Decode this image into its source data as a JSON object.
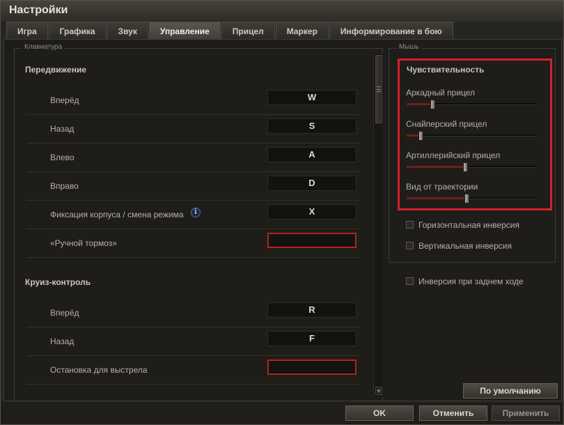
{
  "window": {
    "title": "Настройки"
  },
  "tabs": [
    {
      "label": "Игра",
      "active": false
    },
    {
      "label": "Графика",
      "active": false
    },
    {
      "label": "Звук",
      "active": false
    },
    {
      "label": "Управление",
      "active": true
    },
    {
      "label": "Прицел",
      "active": false
    },
    {
      "label": "Маркер",
      "active": false
    },
    {
      "label": "Информирование в бою",
      "active": false
    }
  ],
  "keyboard": {
    "legend": "Клавиатура",
    "sections": [
      {
        "title": "Передвижение",
        "rows": [
          {
            "label": "Вперёд",
            "key": "W"
          },
          {
            "label": "Назад",
            "key": "S"
          },
          {
            "label": "Влево",
            "key": "A"
          },
          {
            "label": "Вправо",
            "key": "D"
          },
          {
            "label": "Фиксация корпуса / смена режима",
            "key": "X",
            "info": true
          },
          {
            "label": "«Ручной тормоз»",
            "key": ""
          }
        ]
      },
      {
        "title": "Круиз-контроль",
        "rows": [
          {
            "label": "Вперёд",
            "key": "R"
          },
          {
            "label": "Назад",
            "key": "F"
          },
          {
            "label": "Остановка для выстрела",
            "key": ""
          }
        ]
      }
    ]
  },
  "mouse": {
    "legend": "Мышь",
    "sensitivity": {
      "title": "Чувствительность",
      "sliders": [
        {
          "label": "Аркадный прицел",
          "value": 0.2
        },
        {
          "label": "Снайперский прицел",
          "value": 0.11
        },
        {
          "label": "Артиллерийский прицел",
          "value": 0.45
        },
        {
          "label": "Вид от траектории",
          "value": 0.46
        }
      ]
    },
    "checkboxes": [
      {
        "label": "Горизонтальная инверсия",
        "checked": false
      },
      {
        "label": "Вертикальная инверсия",
        "checked": false
      }
    ]
  },
  "reverse_inversion": {
    "label": "Инверсия при заднем ходе",
    "checked": false
  },
  "buttons": {
    "default": "По умолчанию",
    "ok": "OK",
    "cancel": "Отменить",
    "apply": "Применить"
  },
  "colors": {
    "highlight_red": "#d3212a",
    "empty_key_border": "#b3231e"
  },
  "icons": {
    "info": "info-icon",
    "scroll_down": "chevron-down-icon"
  }
}
